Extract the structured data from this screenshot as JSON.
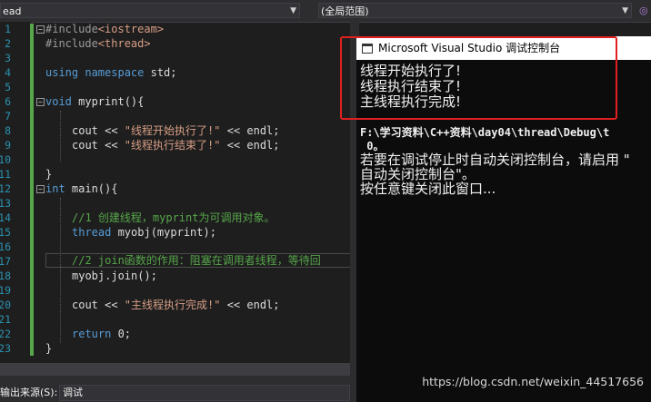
{
  "toolbar": {
    "left_dropdown": "ead",
    "scope_dropdown": "(全局范围)",
    "right_icon": "◎"
  },
  "editor": {
    "line_numbers": [
      "1",
      "2",
      "3",
      "4",
      "5",
      "6",
      "7",
      "8",
      "9",
      "10",
      "11",
      "12",
      "13",
      "14",
      "15",
      "16",
      "17",
      "18",
      "19",
      "20",
      "21",
      "22",
      "23"
    ],
    "lines": {
      "l1_a": "#include",
      "l1_b": "<iostream>",
      "l2_a": "#include",
      "l2_b": "<thread>",
      "l4_a": "using namespace",
      "l4_b": " std;",
      "l6_a": "void",
      "l6_b": " myprint(){",
      "l8_a": "cout << ",
      "l8_b": "\"线程开始执行了!\"",
      "l8_c": " << endl;",
      "l9_a": "cout << ",
      "l9_b": "\"线程执行结束了!\"",
      "l9_c": " << endl;",
      "l11": "}",
      "l12_a": "int",
      "l12_b": " main(){",
      "l14": "//1 创建线程，myprint为可调用对象。",
      "l15_a": "thread",
      "l15_b": " myobj(myprint);",
      "l17": "//2 join函数的作用：阻塞在调用者线程，等待回",
      "l18": "myobj.join();",
      "l20_a": "cout << ",
      "l20_b": "\"主线程执行完成!\"",
      "l20_c": " << endl;",
      "l22_a": "return",
      "l22_b": " 0;",
      "l23": "}"
    }
  },
  "output_panel": {
    "label": "输出来源(S):",
    "source_value": "调试"
  },
  "console": {
    "title": "Microsoft Visual Studio 调试控制台",
    "line1": "线程开始执行了!",
    "line2": "线程执行结束了!",
    "line3": "主线程执行完成!",
    "line4": "F:\\学习资料\\C++资料\\day04\\thread\\Debug\\t",
    "line5": " 0。",
    "line6": "若要在调试停止时自动关闭控制台，请启用 \"",
    "line7": "自动关闭控制台\"。",
    "line8": "按任意键关闭此窗口..."
  },
  "watermark": "https://blog.csdn.net/weixin_44517656",
  "colors": {
    "highlight_box": "#e02020",
    "keyword": "#569cd6",
    "string": "#d69d85",
    "comment": "#57a64a",
    "line_number": "#2b91af"
  }
}
